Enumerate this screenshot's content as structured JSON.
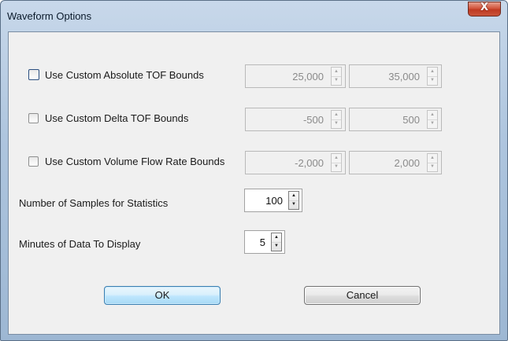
{
  "window": {
    "title": "Waveform Options",
    "close_glyph": "X"
  },
  "options": [
    {
      "label": "Use Custom Absolute TOF Bounds",
      "checked": false,
      "focused": true,
      "min": "25,000",
      "max": "35,000"
    },
    {
      "label": "Use Custom Delta TOF Bounds",
      "checked": false,
      "focused": false,
      "min": "-500",
      "max": "500"
    },
    {
      "label": "Use Custom Volume Flow Rate Bounds",
      "checked": false,
      "focused": false,
      "min": "-2,000",
      "max": "2,000"
    }
  ],
  "samples": {
    "label": "Number of Samples for Statistics",
    "value": "100"
  },
  "minutes": {
    "label": "Minutes of Data To Display",
    "value": "5"
  },
  "buttons": {
    "ok": "OK",
    "cancel": "Cancel"
  },
  "spinner_glyphs": {
    "up": "▲",
    "down": "▼"
  },
  "colors": {
    "title_bar": "#aec5de",
    "client_bg": "#f0f0f0",
    "close_button": "#c9543a",
    "ok_border": "#3c7fb1"
  }
}
